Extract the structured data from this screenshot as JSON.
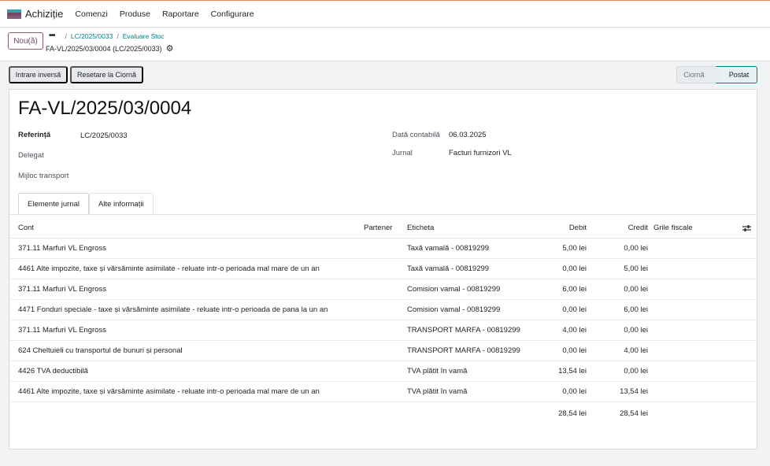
{
  "nav": {
    "app_name": "Achiziție",
    "menu": [
      "Comenzi",
      "Produse",
      "Raportare",
      "Configurare"
    ]
  },
  "control_panel": {
    "new_label": "Nou(ă)",
    "breadcrumb": [
      "LC/2025/0033",
      "Evaluare Stoc"
    ],
    "record_title": "FA-VL/2025/03/0004 (LC/2025/0033)"
  },
  "actions": {
    "reverse_label": "Intrare inversă",
    "reset_label": "Resetare la Ciornă"
  },
  "status": {
    "draft": "Ciornă",
    "posted": "Postat"
  },
  "form": {
    "name": "FA-VL/2025/03/0004",
    "ref_label": "Referință",
    "ref_value": "LC/2025/0033",
    "delegat_label": "Delegat",
    "transport_label": "Mijloc transport",
    "date_label": "Dată contabilă",
    "date_value": "06.03.2025",
    "journal_label": "Jurnal",
    "journal_value": "Facturi furnizori VL"
  },
  "tabs": [
    "Elemente jurnal",
    "Alte informații"
  ],
  "table": {
    "headers": {
      "account": "Cont",
      "partner": "Partener",
      "label": "Eticheta",
      "debit": "Debit",
      "credit": "Credit",
      "tax_grids": "Grile fiscale"
    },
    "rows": [
      {
        "account": "371.11 Marfuri VL Engross",
        "label": "Taxă vamală - 00819299",
        "debit": "5,00 lei",
        "credit": "0,00 lei"
      },
      {
        "account": "4461 Alte impozite, taxe și vărsăminte asimilate - reluate intr-o perioada mal mare de un an",
        "label": "Taxă vamală - 00819299",
        "debit": "0,00 lei",
        "credit": "5,00 lei"
      },
      {
        "account": "371.11 Marfuri VL Engross",
        "label": "Comision vamal - 00819299",
        "debit": "6,00 lei",
        "credit": "0,00 lei"
      },
      {
        "account": "4471 Fonduri speciale - taxe și vărsăminte asimilate - reluate intr-o perioada de pana la un an",
        "label": "Comision vamal - 00819299",
        "debit": "0,00 lei",
        "credit": "6,00 lei"
      },
      {
        "account": "371.11 Marfuri VL Engross",
        "label": "TRANSPORT MARFA - 00819299",
        "debit": "4,00 lei",
        "credit": "0,00 lei"
      },
      {
        "account": "624 Cheltuieli cu transportul de bunuri și personal",
        "label": "TRANSPORT MARFA - 00819299",
        "debit": "0,00 lei",
        "credit": "4,00 lei"
      },
      {
        "account": "4426 TVA deductibilă",
        "label": "TVA plătit în vamă",
        "debit": "13,54 lei",
        "credit": "0,00 lei"
      },
      {
        "account": "4461 Alte impozite, taxe și vărsăminte asimilate - reluate intr-o perioada mal mare de un an",
        "label": "TVA plătit în vamă",
        "debit": "0,00 lei",
        "credit": "13,54 lei"
      }
    ],
    "total_debit": "28,54 lei",
    "total_credit": "28,54 lei"
  },
  "colors": {
    "brand": "#714b67",
    "accent": "#017e84"
  },
  "icons": [
    "app-logo-icon",
    "gear-icon",
    "column-settings-icon"
  ]
}
